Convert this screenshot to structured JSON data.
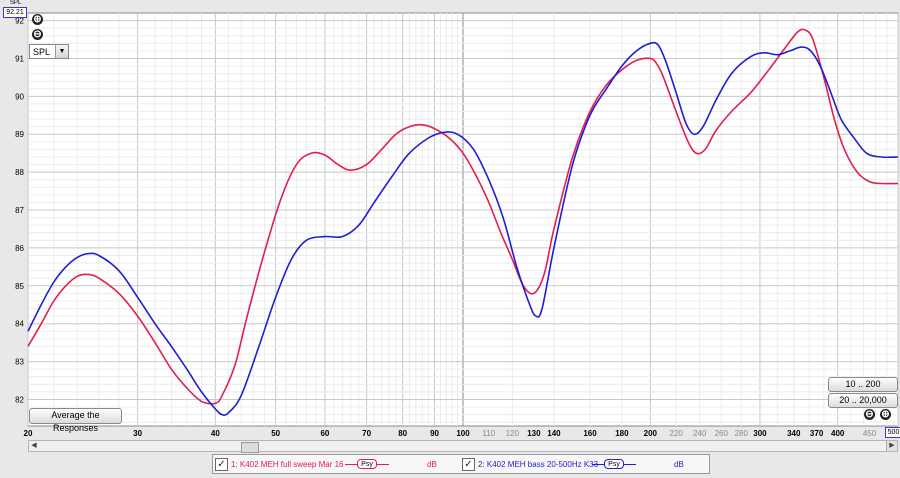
{
  "chart_data": {
    "type": "line",
    "xscale": "log",
    "xlim": [
      20,
      500
    ],
    "ylim": [
      81.3,
      92.2
    ],
    "ylabel": "SPL",
    "y_top_value": "92.21",
    "x_end_value": "500",
    "x_ticks": [
      "20",
      "30",
      "40",
      "50",
      "60",
      "70",
      "80",
      "90",
      "100",
      "110",
      "120",
      "130",
      "140",
      "160",
      "180",
      "200",
      "220",
      "240",
      "260",
      "280",
      "300",
      "340",
      "370",
      "400",
      "450"
    ],
    "x_tick_values": [
      20,
      30,
      40,
      50,
      60,
      70,
      80,
      90,
      100,
      110,
      120,
      130,
      140,
      160,
      180,
      200,
      220,
      240,
      260,
      280,
      300,
      340,
      370,
      400,
      450
    ],
    "y_ticks": [
      82,
      83,
      84,
      85,
      86,
      87,
      88,
      89,
      90,
      91,
      92
    ],
    "series": [
      {
        "name": "1: K402 MEH full sweep Mar 16",
        "color": "#e0204c",
        "points": [
          [
            20,
            83.4
          ],
          [
            21,
            84.0
          ],
          [
            22,
            84.6
          ],
          [
            23,
            85.0
          ],
          [
            24,
            85.25
          ],
          [
            25,
            85.3
          ],
          [
            26,
            85.2
          ],
          [
            28,
            84.8
          ],
          [
            30,
            84.2
          ],
          [
            32,
            83.5
          ],
          [
            34,
            82.8
          ],
          [
            36,
            82.3
          ],
          [
            38,
            81.95
          ],
          [
            40,
            81.9
          ],
          [
            41,
            82.1
          ],
          [
            43,
            82.9
          ],
          [
            45,
            84.2
          ],
          [
            48,
            85.9
          ],
          [
            51,
            87.3
          ],
          [
            54,
            88.2
          ],
          [
            57,
            88.5
          ],
          [
            60,
            88.45
          ],
          [
            63,
            88.2
          ],
          [
            66,
            88.05
          ],
          [
            70,
            88.2
          ],
          [
            74,
            88.6
          ],
          [
            78,
            89.0
          ],
          [
            82,
            89.2
          ],
          [
            86,
            89.25
          ],
          [
            90,
            89.15
          ],
          [
            95,
            88.9
          ],
          [
            100,
            88.5
          ],
          [
            105,
            87.9
          ],
          [
            110,
            87.2
          ],
          [
            115,
            86.4
          ],
          [
            120,
            85.7
          ],
          [
            125,
            85.0
          ],
          [
            130,
            84.8
          ],
          [
            135,
            85.3
          ],
          [
            140,
            86.5
          ],
          [
            150,
            88.4
          ],
          [
            160,
            89.6
          ],
          [
            170,
            90.3
          ],
          [
            180,
            90.7
          ],
          [
            190,
            90.95
          ],
          [
            200,
            91.0
          ],
          [
            205,
            90.85
          ],
          [
            210,
            90.5
          ],
          [
            220,
            89.6
          ],
          [
            230,
            88.8
          ],
          [
            237,
            88.5
          ],
          [
            245,
            88.6
          ],
          [
            255,
            89.1
          ],
          [
            270,
            89.6
          ],
          [
            290,
            90.1
          ],
          [
            310,
            90.7
          ],
          [
            330,
            91.3
          ],
          [
            345,
            91.7
          ],
          [
            355,
            91.75
          ],
          [
            365,
            91.5
          ],
          [
            380,
            90.5
          ],
          [
            395,
            89.4
          ],
          [
            410,
            88.6
          ],
          [
            430,
            88.0
          ],
          [
            450,
            87.75
          ],
          [
            470,
            87.7
          ],
          [
            500,
            87.7
          ]
        ]
      },
      {
        "name": "2: K402 MEH bass 20-500Hz K33",
        "color": "#1e1ed2",
        "points": [
          [
            20,
            83.8
          ],
          [
            21,
            84.5
          ],
          [
            22,
            85.1
          ],
          [
            23,
            85.5
          ],
          [
            24,
            85.75
          ],
          [
            25,
            85.85
          ],
          [
            26,
            85.8
          ],
          [
            28,
            85.4
          ],
          [
            30,
            84.7
          ],
          [
            32,
            84.0
          ],
          [
            34,
            83.4
          ],
          [
            36,
            82.8
          ],
          [
            38,
            82.2
          ],
          [
            40,
            81.75
          ],
          [
            41,
            81.6
          ],
          [
            42,
            81.65
          ],
          [
            44,
            82.1
          ],
          [
            47,
            83.4
          ],
          [
            50,
            84.7
          ],
          [
            53,
            85.7
          ],
          [
            56,
            86.2
          ],
          [
            60,
            86.3
          ],
          [
            64,
            86.3
          ],
          [
            68,
            86.6
          ],
          [
            72,
            87.2
          ],
          [
            77,
            87.9
          ],
          [
            82,
            88.5
          ],
          [
            88,
            88.9
          ],
          [
            93,
            89.05
          ],
          [
            98,
            89.0
          ],
          [
            104,
            88.6
          ],
          [
            110,
            87.8
          ],
          [
            116,
            86.8
          ],
          [
            122,
            85.5
          ],
          [
            128,
            84.5
          ],
          [
            131,
            84.2
          ],
          [
            134,
            84.4
          ],
          [
            140,
            86.0
          ],
          [
            150,
            88.2
          ],
          [
            160,
            89.5
          ],
          [
            170,
            90.2
          ],
          [
            180,
            90.8
          ],
          [
            190,
            91.2
          ],
          [
            200,
            91.4
          ],
          [
            206,
            91.35
          ],
          [
            212,
            90.9
          ],
          [
            220,
            90.1
          ],
          [
            228,
            89.3
          ],
          [
            235,
            89.0
          ],
          [
            243,
            89.2
          ],
          [
            255,
            89.9
          ],
          [
            270,
            90.6
          ],
          [
            290,
            91.05
          ],
          [
            305,
            91.15
          ],
          [
            320,
            91.1
          ],
          [
            335,
            91.2
          ],
          [
            350,
            91.3
          ],
          [
            362,
            91.2
          ],
          [
            375,
            90.8
          ],
          [
            390,
            90.1
          ],
          [
            405,
            89.4
          ],
          [
            425,
            88.9
          ],
          [
            445,
            88.5
          ],
          [
            470,
            88.4
          ],
          [
            500,
            88.4
          ]
        ]
      }
    ]
  },
  "controls": {
    "spl_select": "SPL",
    "average_button": "Average the Responses",
    "range1_button": "10 .. 200",
    "range2_button": "20 .. 20,000",
    "zoom_in": "⊕",
    "zoom_out": "⊖"
  },
  "legend": {
    "entries": [
      {
        "label": "1: K402 MEH full sweep Mar 16",
        "psy": "Psy",
        "unit": "dB",
        "color": "#e0204c",
        "checked": true
      },
      {
        "label": "2: K402 MEH bass 20-500Hz K33",
        "psy": "Psy",
        "unit": "dB",
        "color": "#1e1ed2",
        "checked": true
      }
    ]
  }
}
